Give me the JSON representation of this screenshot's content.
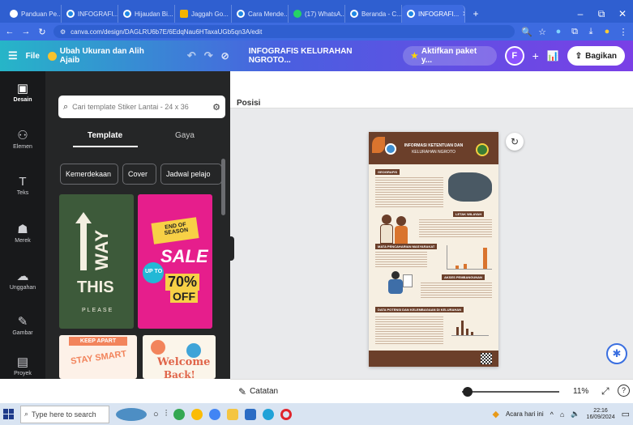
{
  "browser": {
    "tabs": [
      {
        "label": "Panduan Pe...",
        "color": "#ffffff"
      },
      {
        "label": "INFOGRAFI...",
        "color": "#1e88e5"
      },
      {
        "label": "Hijaudan Bi...",
        "color": "#1e88e5"
      },
      {
        "label": "Jaggah Go...",
        "color": "#f4b400"
      },
      {
        "label": "Cara Mende...",
        "color": "#1e88e5"
      },
      {
        "label": "(17) WhatsA...",
        "color": "#25d366"
      },
      {
        "label": "Beranda - C...",
        "color": "#1e88e5"
      },
      {
        "label": "INFOGRAFI...",
        "color": "#1e88e5"
      }
    ],
    "url": "canva.com/design/DAGLRU6b7E/6EdqNau6HTaxaUGb5qn3A/edit",
    "new_tab_symbol": "+",
    "minimize_symbol": "–",
    "restore_symbol": "⧉",
    "close_symbol": "✕"
  },
  "canva_header": {
    "menu_symbol": "☰",
    "file_label": "File",
    "resize_label": "Ubah Ukuran dan Alih Ajaib",
    "title": "INFOGRAFIS KELURAHAN NGROTO...",
    "upgrade_label": "Aktifkan paket y...",
    "avatar_initial": "F",
    "share_label": "Bagikan"
  },
  "rail": [
    {
      "icon": "▣",
      "label": "Desain",
      "active": true
    },
    {
      "icon": "⚇",
      "label": "Elemen",
      "active": false
    },
    {
      "icon": "T",
      "label": "Teks",
      "active": false
    },
    {
      "icon": "☗",
      "label": "Merek",
      "active": false
    },
    {
      "icon": "☁",
      "label": "Unggahan",
      "active": false
    },
    {
      "icon": "✎",
      "label": "Gambar",
      "active": false
    },
    {
      "icon": "▤",
      "label": "Proyek",
      "active": false
    }
  ],
  "panel": {
    "search_placeholder": "Cari template Stiker Lantai - 24 x 36",
    "tabs": [
      {
        "label": "Template",
        "active": true
      },
      {
        "label": "Gaya",
        "active": false
      }
    ],
    "chips": [
      "Kemerdekaan",
      "Cover",
      "Jadwal pelajo"
    ],
    "templates": [
      {
        "lines": [
          "WAY",
          "THIS",
          "PLEASE"
        ]
      },
      {
        "lines": [
          "END OF SEASON",
          "SALE",
          "UP TO",
          "70%",
          "OFF"
        ]
      },
      {
        "lines": [
          "KEEP APART",
          "STAY SMART"
        ]
      },
      {
        "lines": [
          "Welcome",
          "Back!"
        ]
      }
    ]
  },
  "canvas": {
    "position_label": "Posisi",
    "notes_label": "Catatan",
    "zoom": "11%",
    "zoom_value": 0.11,
    "refresh_symbol": "↻",
    "fullscreen_symbol": "⤢",
    "help_symbol": "?"
  },
  "infographic": {
    "title_line1": "INFORMASI KETENTUAN DAN",
    "title_line2": "KELURAHAN NGROTO",
    "sections": [
      "GEOGRAFIS",
      "LETAK WILAYAH",
      "MATA PENCAHARIAN MASYARAKAT",
      "AKSES PEMBANGUNAN",
      "DATA POTENSI DAN KELEMBAGAAN DI KELURAHAN"
    ]
  },
  "taskbar": {
    "search_placeholder": "Type here to search",
    "weather": "Acara hari ini",
    "time": "22:16",
    "date": "16/09/2024"
  }
}
